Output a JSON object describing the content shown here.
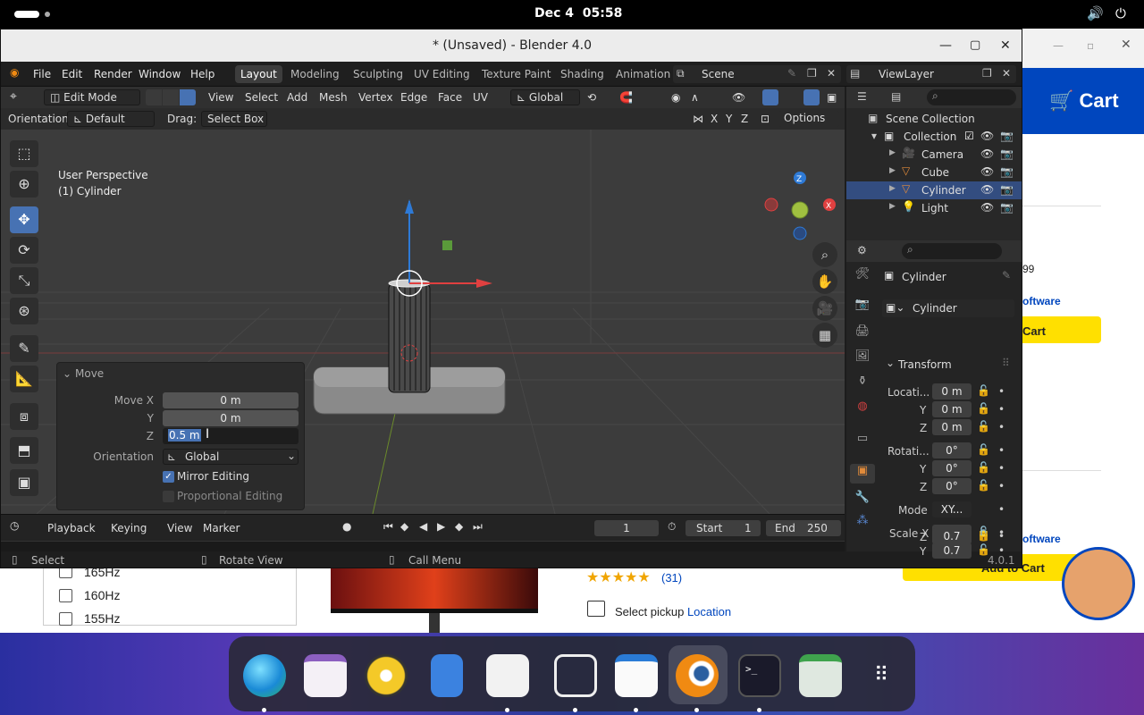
{
  "system": {
    "date": "Dec 4",
    "time": "05:58"
  },
  "window": {
    "title": "* (Unsaved) - Blender 4.0"
  },
  "menu": {
    "items": [
      "File",
      "Edit",
      "Render",
      "Window",
      "Help"
    ],
    "workspaces": [
      "Layout",
      "Modeling",
      "Sculpting",
      "UV Editing",
      "Texture Paint",
      "Shading",
      "Animation"
    ],
    "scene": "Scene",
    "view_layer": "ViewLayer"
  },
  "header": {
    "mode": "Edit Mode",
    "items": [
      "View",
      "Select",
      "Add",
      "Mesh",
      "Vertex",
      "Edge",
      "Face",
      "UV"
    ],
    "transform": "Global",
    "axes": [
      "X",
      "Y",
      "Z"
    ],
    "options": "Options"
  },
  "tool_settings": {
    "orientation_label": "Orientation:",
    "orientation": "Default",
    "drag_label": "Drag:",
    "drag": "Select Box"
  },
  "viewport": {
    "view_name": "User Perspective",
    "object_label": "(1) Cylinder"
  },
  "move_panel": {
    "title": "Move",
    "move_x_label": "Move X",
    "move_x": "0 m",
    "y_label": "Y",
    "y": "0 m",
    "z_label": "Z",
    "z": "0.5 m",
    "orientation_label": "Orientation",
    "orientation": "Global",
    "mirror_label": "Mirror Editing",
    "mirror": true,
    "proportional_label": "Proportional Editing",
    "proportional": false
  },
  "timeline": {
    "playback": "Playback",
    "keying": "Keying",
    "view": "View",
    "marker": "Marker",
    "current_frame": "1",
    "start_label": "Start",
    "start": "1",
    "end_label": "End",
    "end": "250"
  },
  "status": {
    "select": "Select",
    "rotate": "Rotate View",
    "menu": "Call Menu",
    "version": "4.0.1"
  },
  "outliner": {
    "root": "Scene Collection",
    "collection": "Collection",
    "objects": [
      "Camera",
      "Cube",
      "Cylinder",
      "Light"
    ]
  },
  "properties": {
    "object_name": "Cylinder",
    "data_name": "Cylinder",
    "section": "Transform",
    "location_label": "Locati...",
    "location": [
      "0 m",
      "0 m",
      "0 m"
    ],
    "rotation_label": "Rotati...",
    "rotation": [
      "0°",
      "0°",
      "0°"
    ],
    "mode_label": "Mode",
    "mode": "XY...",
    "scale_label": "Scale X",
    "scale": [
      "0.7",
      "0.7",
      "0.7"
    ],
    "axis_labels": [
      "Y",
      "Z"
    ]
  },
  "website": {
    "cart": "Cart",
    "price_frag": "99",
    "software1": "oftware",
    "add_cart1": "Cart",
    "software2": "oftware",
    "add_to_cart": "Add to Cart",
    "refresh_rates": [
      "165Hz",
      "160Hz",
      "155Hz"
    ],
    "rating_count": "(31)",
    "pickup_text": "Select pickup",
    "pickup_link": "Location"
  },
  "colors": {
    "accent": "#4772b3",
    "cart_blue": "#0046be",
    "cart_yellow": "#ffe000"
  }
}
